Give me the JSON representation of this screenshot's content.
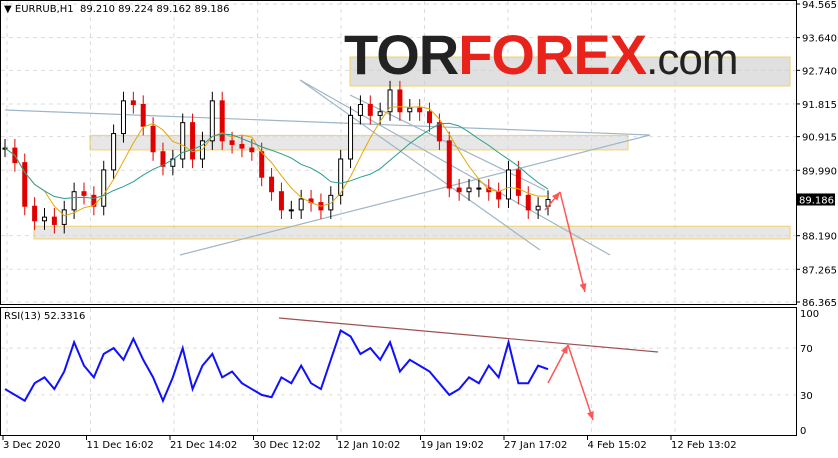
{
  "header": {
    "symbol": "EURRUB,H1",
    "ohlc": "89.210 89.224 89.162 89.186"
  },
  "logo": {
    "part1": "TOR",
    "part2": "FOREX",
    "part3": ".com"
  },
  "rsi_label": "RSI(13) 52.3316",
  "colors": {
    "up": "#000000",
    "down": "#e00000",
    "ma_fast": "#e6a700",
    "ma_slow": "#2a9d8f",
    "rsi": "#1010ff",
    "zone_border": "#f0b400",
    "arrow": "#ff5555",
    "trend": "#9fb6c6"
  },
  "chart_data": [
    {
      "type": "candlestick",
      "title": "EURRUB,H1",
      "ylim": [
        86.365,
        94.565
      ],
      "y_ticks": [
        "94.565",
        "93.640",
        "92.740",
        "91.815",
        "90.915",
        "89.990",
        "88.190",
        "87.265",
        "86.365"
      ],
      "current_price": "89.186",
      "x_labels": [
        "3 Dec 2020",
        "11 Dec 16:02",
        "21 Dec 14:02",
        "30 Dec 12:02",
        "12 Jan 10:02",
        "19 Jan 19:02",
        "27 Jan 17:02",
        "4 Feb 15:02",
        "12 Feb 13:02"
      ],
      "close": [
        90.6,
        90.2,
        89.0,
        88.6,
        88.7,
        88.5,
        88.9,
        89.4,
        89.3,
        89.0,
        90.0,
        91.0,
        91.9,
        91.8,
        91.2,
        90.5,
        90.1,
        90.3,
        91.3,
        90.3,
        90.8,
        91.9,
        90.8,
        90.7,
        90.6,
        90.5,
        89.8,
        89.4,
        88.9,
        88.9,
        89.2,
        89.1,
        88.9,
        89.3,
        90.3,
        91.5,
        91.8,
        91.5,
        91.6,
        92.2,
        91.6,
        91.7,
        91.6,
        91.3,
        90.8,
        89.5,
        89.4,
        89.5,
        89.5,
        89.4,
        89.2,
        90.0,
        89.3,
        88.9,
        89.0,
        89.186
      ],
      "support_zones": [
        [
          90.55,
          90.95
        ],
        [
          88.1,
          88.45
        ]
      ]
    },
    {
      "type": "line",
      "title": "RSI(13) 52.3316",
      "ylim": [
        0,
        100
      ],
      "y_ticks": [
        "100",
        "70",
        "30",
        "0"
      ],
      "values": [
        35,
        30,
        25,
        40,
        45,
        35,
        50,
        75,
        55,
        45,
        65,
        70,
        60,
        78,
        60,
        45,
        25,
        45,
        70,
        35,
        55,
        65,
        45,
        50,
        40,
        35,
        30,
        28,
        45,
        40,
        55,
        40,
        35,
        60,
        85,
        80,
        65,
        70,
        60,
        75,
        50,
        60,
        55,
        50,
        40,
        30,
        35,
        45,
        40,
        55,
        45,
        75,
        40,
        40,
        55,
        52
      ]
    }
  ]
}
